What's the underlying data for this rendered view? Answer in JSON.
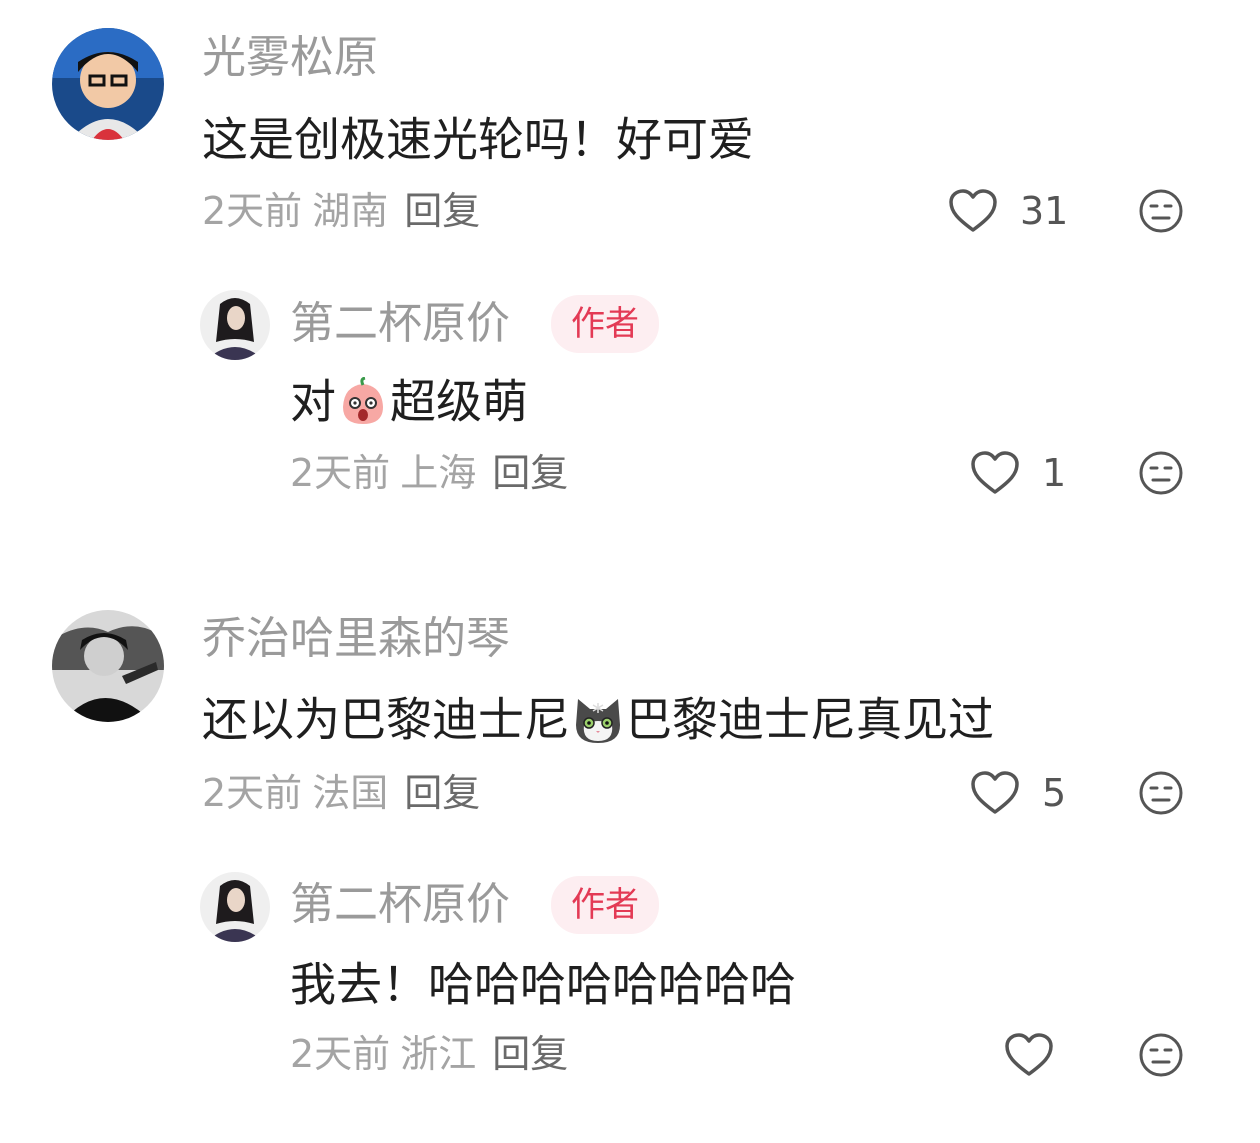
{
  "comments": [
    {
      "username": "光雾松原",
      "text_parts": [
        "这是创极速光轮吗！好可爱"
      ],
      "meta": {
        "time": "2天前",
        "location": "湖南",
        "reply": "回复"
      },
      "likes": "31",
      "reply": {
        "username": "第二杯原价",
        "badge": "作者",
        "text_before": "对",
        "emoji": "shocked-peach-emoji",
        "text_after": "超级萌",
        "meta": {
          "time": "2天前",
          "location": "上海",
          "reply": "回复"
        },
        "likes": "1"
      }
    },
    {
      "username": "乔治哈里森的琴",
      "text_before": "还以为巴黎迪士尼",
      "emoji": "cat-emoji",
      "text_after": "巴黎迪士尼真见过",
      "meta": {
        "time": "2天前",
        "location": "法国",
        "reply": "回复"
      },
      "likes": "5",
      "reply": {
        "username": "第二杯原价",
        "badge": "作者",
        "text": "我去！哈哈哈哈哈哈哈哈",
        "meta": {
          "time": "2天前",
          "location": "浙江",
          "reply": "回复"
        },
        "likes": ""
      }
    }
  ],
  "icons": {
    "like": "heart-outline-icon",
    "dislike": "unamused-face-icon"
  },
  "colors": {
    "badge_text": "#e33a55",
    "badge_bg": "#fdeef1",
    "username": "#9a9a9a"
  }
}
